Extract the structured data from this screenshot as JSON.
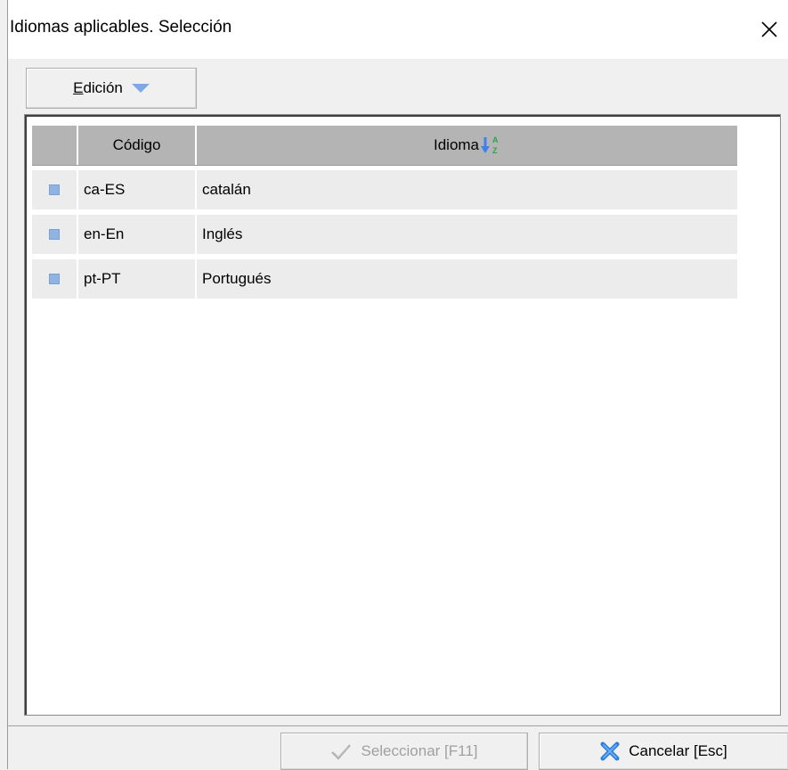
{
  "window": {
    "title": "Idiomas aplicables. Selección",
    "close_icon": "close-icon"
  },
  "toolbar": {
    "edit_label": "Edición",
    "edit_icon": "chevron-down-icon",
    "accent": "#6b9be6"
  },
  "grid": {
    "columns": [
      {
        "label": ""
      },
      {
        "label": "Código"
      },
      {
        "label": "Idioma",
        "sort_icon": "sort-az-icon"
      }
    ],
    "rows": [
      {
        "code": "ca-ES",
        "language": "catalán"
      },
      {
        "code": "en-En",
        "language": "Inglés"
      },
      {
        "code": "pt-PT",
        "language": "Portugués"
      }
    ],
    "row_marker_color": "#8fb3e3"
  },
  "footer": {
    "select_label": "Seleccionar [F11]",
    "select_icon": "check-icon",
    "select_disabled": true,
    "cancel_label": "Cancelar [Esc]",
    "cancel_icon": "cancel-x-icon",
    "cancel_icon_color": "#2f7fd9"
  }
}
